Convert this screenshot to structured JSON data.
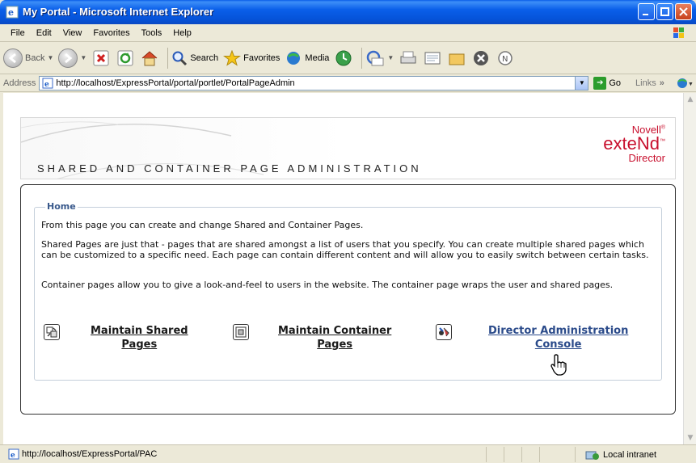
{
  "window": {
    "title": "My Portal - Microsoft Internet Explorer"
  },
  "menu": {
    "items": [
      "File",
      "Edit",
      "View",
      "Favorites",
      "Tools",
      "Help"
    ]
  },
  "toolbar": {
    "back": "Back",
    "search": "Search",
    "favorites": "Favorites",
    "media": "Media"
  },
  "address": {
    "label": "Address",
    "url": "http://localhost/ExpressPortal/portal/portlet/PortalPageAdmin",
    "go": "Go",
    "links": "Links",
    "links_chevron": "»"
  },
  "header": {
    "page_heading": "SHARED AND CONTAINER PAGE ADMINISTRATION",
    "brand_line1": "Novell",
    "brand_reg": "®",
    "brand_line2": "exteNd",
    "brand_tm": "™",
    "brand_line3": "Director"
  },
  "content": {
    "legend": "Home",
    "para1": "From this page you can create and change Shared and Container Pages.",
    "para2": "Shared Pages are just that - pages that are shared amongst a list of users that you specify. You can create multiple shared pages which can be customized to a specific need. Each page can contain different content and will allow you to easily switch between certain tasks.",
    "para3": "Container pages allow you to give a look-and-feel to users in the website. The container page wraps the user and shared pages.",
    "links": [
      {
        "line1": "Maintain Shared",
        "line2": "Pages",
        "icon": "shared-pages-icon"
      },
      {
        "line1": "Maintain Container",
        "line2": "Pages",
        "icon": "container-pages-icon"
      },
      {
        "line1": "Director Administration",
        "line2": "Console",
        "icon": "admin-console-icon"
      }
    ]
  },
  "status": {
    "url": "http://localhost/ExpressPortal/PAC",
    "zone": "Local intranet"
  },
  "colors": {
    "titlebar": "#0a5ee8",
    "brand": "#c8102e",
    "link_blue": "#2a4a8a",
    "legend": "#3a5a8c"
  }
}
